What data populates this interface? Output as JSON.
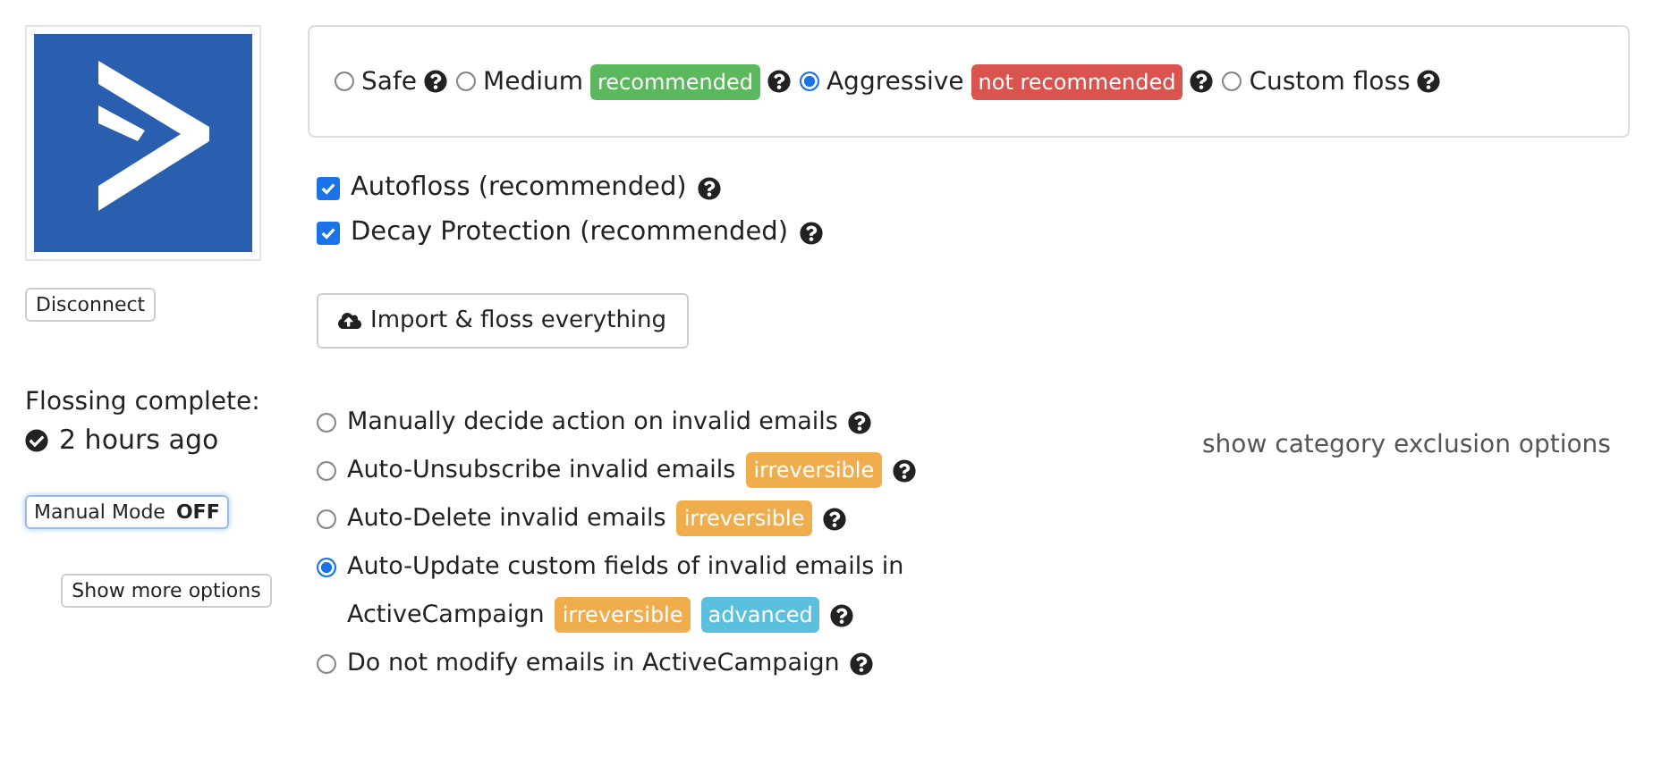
{
  "modes": [
    {
      "label": "Safe",
      "selected": false
    },
    {
      "label": "Medium",
      "selected": false,
      "badges": [
        {
          "text": "recommended",
          "color": "#5cb85c"
        }
      ]
    },
    {
      "label": "Aggressive",
      "selected": true,
      "badges": [
        {
          "text": "not recommended",
          "color": "#d9534f"
        }
      ]
    },
    {
      "label": "Custom floss",
      "selected": false
    }
  ],
  "checkboxes": [
    {
      "label": "Autofloss (recommended)",
      "checked": true
    },
    {
      "label": "Decay Protection (recommended)",
      "checked": true
    }
  ],
  "disconnect_button": "Disconnect",
  "import_button": "Import & floss everything",
  "status": {
    "title": "Flossing complete:",
    "time": "2 hours ago"
  },
  "manual_mode": {
    "label": "Manual Mode",
    "value": "OFF"
  },
  "more_options_button": "Show more options",
  "actions": [
    {
      "label": "Manually decide action on invalid emails",
      "selected": false
    },
    {
      "label": "Auto-Unsubscribe invalid emails",
      "selected": false,
      "badges": [
        {
          "text": "irreversible",
          "color": "#f0ad4e"
        }
      ]
    },
    {
      "label": "Auto-Delete invalid emails",
      "selected": false,
      "badges": [
        {
          "text": "irreversible",
          "color": "#f0ad4e"
        }
      ]
    },
    {
      "label": "Auto-Update custom fields of invalid emails in",
      "label_continued": "ActiveCampaign",
      "selected": true,
      "badges": [
        {
          "text": "irreversible",
          "color": "#f0ad4e"
        },
        {
          "text": "advanced",
          "color": "#5bc0de"
        }
      ]
    },
    {
      "label": "Do not modify emails in ActiveCampaign",
      "selected": false
    }
  ],
  "category_link": "show category exclusion options"
}
